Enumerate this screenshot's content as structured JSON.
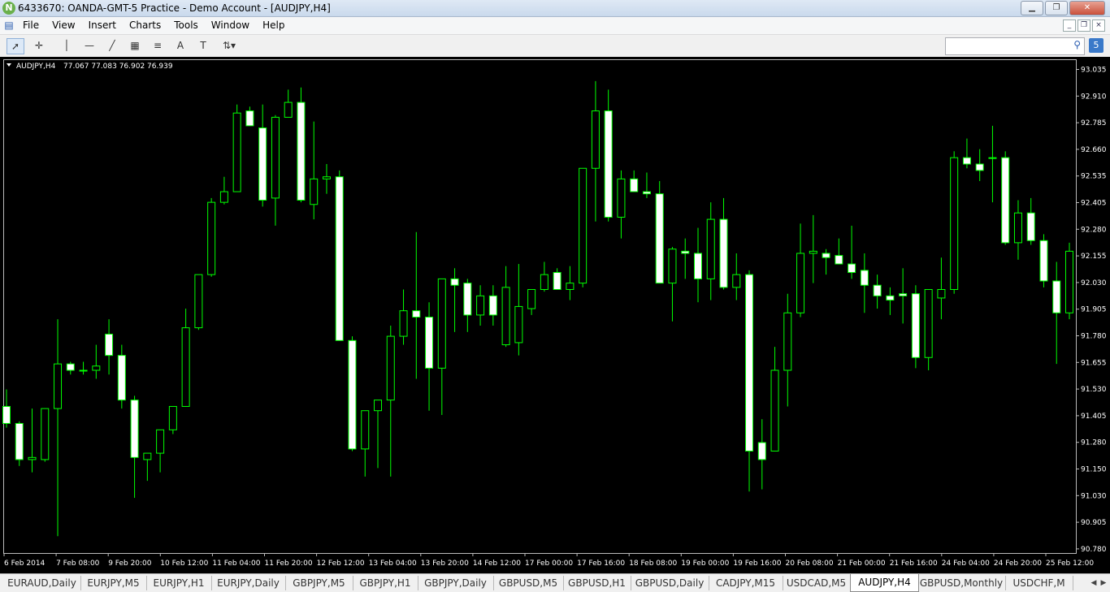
{
  "window": {
    "title": "6433670: OANDA-GMT-5 Practice - Demo Account - [AUDJPY,H4]",
    "app_icon": "N",
    "minimize": "▁",
    "maximize": "❐",
    "close": "✕"
  },
  "menu": {
    "items": [
      "File",
      "View",
      "Insert",
      "Charts",
      "Tools",
      "Window",
      "Help"
    ],
    "mdi": [
      "_",
      "❐",
      "×"
    ]
  },
  "toolbar": {
    "tools": [
      {
        "name": "cursor-icon",
        "glyph": "➚"
      },
      {
        "name": "crosshair-icon",
        "glyph": "✛"
      },
      {
        "name": "vertical-line-icon",
        "glyph": "│"
      },
      {
        "name": "horizontal-line-icon",
        "glyph": "—"
      },
      {
        "name": "trendline-icon",
        "glyph": "╱"
      },
      {
        "name": "equidistant-channel-icon",
        "glyph": "▦"
      },
      {
        "name": "fibonacci-icon",
        "glyph": "≡"
      },
      {
        "name": "text-icon",
        "glyph": "A"
      },
      {
        "name": "text-label-icon",
        "glyph": "T"
      },
      {
        "name": "arrows-icon",
        "glyph": "⇅▾"
      }
    ],
    "search_placeholder": "",
    "search_glyph": "⚲",
    "message_glyph": "5"
  },
  "colors": {
    "background": "#000000",
    "candle_line": "#00ff00",
    "bull_body": "#000000",
    "bear_body": "#ffffff",
    "text": "#ffffff"
  },
  "chart_data": {
    "type": "candlestick",
    "symbol_label": "AUDJPY,H4",
    "ohlc_label": "77.067 77.083 76.902 76.939",
    "y_ticks": [
      "93.035",
      "92.910",
      "92.785",
      "92.660",
      "92.535",
      "92.405",
      "92.280",
      "92.155",
      "92.030",
      "91.905",
      "91.780",
      "91.655",
      "91.530",
      "91.405",
      "91.280",
      "91.150",
      "91.030",
      "90.905",
      "90.780"
    ],
    "x_labels": [
      "6 Feb 2014",
      "7 Feb 08:00",
      "9 Feb 20:00",
      "10 Feb 12:00",
      "11 Feb 04:00",
      "11 Feb 20:00",
      "12 Feb 12:00",
      "13 Feb 04:00",
      "13 Feb 20:00",
      "14 Feb 12:00",
      "17 Feb 00:00",
      "17 Feb 16:00",
      "18 Feb 08:00",
      "19 Feb 00:00",
      "19 Feb 16:00",
      "20 Feb 08:00",
      "21 Feb 00:00",
      "21 Feb 16:00",
      "24 Feb 04:00",
      "24 Feb 20:00",
      "25 Feb 12:00"
    ],
    "ylim": [
      90.75,
      93.06
    ],
    "grid": false,
    "candles": [
      [
        91.45,
        91.53,
        91.35,
        91.37
      ],
      [
        91.37,
        91.38,
        91.17,
        91.2
      ],
      [
        91.2,
        91.44,
        91.14,
        91.21
      ],
      [
        91.2,
        91.44,
        91.19,
        91.44
      ],
      [
        91.44,
        91.86,
        90.84,
        91.65
      ],
      [
        91.65,
        91.66,
        91.6,
        91.62
      ],
      [
        91.62,
        91.66,
        91.6,
        91.62
      ],
      [
        91.62,
        91.74,
        91.58,
        91.64
      ],
      [
        91.79,
        91.86,
        91.6,
        91.69
      ],
      [
        91.69,
        91.74,
        91.44,
        91.48
      ],
      [
        91.48,
        91.5,
        91.02,
        91.21
      ],
      [
        91.2,
        91.23,
        91.1,
        91.23
      ],
      [
        91.23,
        91.33,
        91.14,
        91.34
      ],
      [
        91.34,
        91.45,
        91.32,
        91.45
      ],
      [
        91.45,
        91.91,
        91.45,
        91.82
      ],
      [
        91.82,
        92.07,
        91.81,
        92.07
      ],
      [
        92.07,
        92.43,
        92.06,
        92.41
      ],
      [
        92.41,
        92.53,
        92.4,
        92.46
      ],
      [
        92.46,
        92.87,
        92.46,
        92.83
      ],
      [
        92.84,
        92.86,
        92.79,
        92.77
      ],
      [
        92.76,
        92.87,
        92.39,
        92.42
      ],
      [
        92.43,
        92.82,
        92.3,
        92.81
      ],
      [
        92.81,
        92.94,
        92.81,
        92.88
      ],
      [
        92.88,
        92.95,
        92.41,
        92.42
      ],
      [
        92.4,
        92.79,
        92.33,
        92.52
      ],
      [
        92.52,
        92.59,
        92.45,
        92.53
      ],
      [
        92.53,
        92.56,
        91.76,
        91.76
      ],
      [
        91.76,
        91.78,
        91.24,
        91.25
      ],
      [
        91.25,
        91.43,
        91.12,
        91.43
      ],
      [
        91.43,
        91.48,
        91.16,
        91.48
      ],
      [
        91.48,
        91.83,
        91.12,
        91.78
      ],
      [
        91.78,
        92.0,
        91.74,
        91.9
      ],
      [
        91.9,
        92.27,
        91.58,
        91.87
      ],
      [
        91.87,
        91.94,
        91.43,
        91.63
      ],
      [
        91.63,
        92.05,
        91.41,
        92.05
      ],
      [
        92.05,
        92.1,
        91.8,
        92.02
      ],
      [
        92.03,
        92.05,
        91.8,
        91.88
      ],
      [
        91.88,
        92.02,
        91.83,
        91.97
      ],
      [
        91.97,
        92.02,
        91.83,
        91.88
      ],
      [
        91.74,
        92.11,
        91.73,
        92.01
      ],
      [
        91.75,
        92.12,
        91.69,
        91.92
      ],
      [
        91.91,
        92.0,
        91.88,
        92.0
      ],
      [
        92.0,
        92.13,
        91.99,
        92.07
      ],
      [
        92.08,
        92.1,
        92.04,
        92.0
      ],
      [
        92.0,
        92.11,
        91.95,
        92.03
      ],
      [
        92.03,
        92.57,
        92.01,
        92.57
      ],
      [
        92.57,
        92.98,
        92.32,
        92.84
      ],
      [
        92.84,
        92.94,
        92.32,
        92.34
      ],
      [
        92.34,
        92.56,
        92.24,
        92.52
      ],
      [
        92.52,
        92.56,
        92.46,
        92.46
      ],
      [
        92.46,
        92.55,
        92.43,
        92.45
      ],
      [
        92.45,
        92.51,
        92.06,
        92.03
      ],
      [
        92.03,
        92.2,
        91.85,
        92.19
      ],
      [
        92.18,
        92.24,
        92.05,
        92.17
      ],
      [
        92.17,
        92.29,
        91.94,
        92.05
      ],
      [
        92.05,
        92.41,
        91.95,
        92.33
      ],
      [
        92.33,
        92.43,
        92.0,
        92.01
      ],
      [
        92.01,
        92.17,
        91.95,
        92.07
      ],
      [
        92.07,
        92.09,
        91.05,
        91.24
      ],
      [
        91.28,
        91.39,
        91.06,
        91.2
      ],
      [
        91.24,
        91.73,
        91.24,
        91.62
      ],
      [
        91.62,
        91.98,
        91.45,
        91.89
      ],
      [
        91.89,
        92.31,
        91.87,
        92.17
      ],
      [
        92.17,
        92.35,
        92.03,
        92.18
      ],
      [
        92.17,
        92.19,
        92.07,
        92.15
      ],
      [
        92.16,
        92.24,
        92.12,
        92.12
      ],
      [
        92.12,
        92.3,
        92.05,
        92.08
      ],
      [
        92.09,
        92.17,
        91.89,
        92.02
      ],
      [
        92.02,
        92.07,
        91.91,
        91.97
      ],
      [
        91.97,
        92.01,
        91.88,
        91.95
      ],
      [
        91.98,
        92.1,
        91.84,
        91.97
      ],
      [
        91.98,
        92.02,
        91.63,
        91.68
      ],
      [
        91.68,
        91.98,
        91.62,
        92.0
      ],
      [
        91.96,
        92.15,
        91.86,
        92.0
      ],
      [
        92.0,
        92.65,
        91.98,
        92.62
      ],
      [
        92.62,
        92.71,
        92.57,
        92.59
      ],
      [
        92.59,
        92.66,
        92.51,
        92.56
      ],
      [
        92.62,
        92.77,
        92.41,
        92.62
      ],
      [
        92.62,
        92.65,
        92.21,
        92.22
      ],
      [
        92.22,
        92.42,
        92.14,
        92.36
      ],
      [
        92.36,
        92.43,
        92.21,
        92.23
      ],
      [
        92.23,
        92.26,
        92.01,
        92.04
      ],
      [
        92.04,
        92.13,
        91.65,
        91.89
      ],
      [
        91.89,
        92.22,
        91.86,
        92.18
      ]
    ]
  },
  "tabs": [
    "EURAUD,Daily",
    "EURJPY,M5",
    "EURJPY,H1",
    "EURJPY,Daily",
    "GBPJPY,M5",
    "GBPJPY,H1",
    "GBPJPY,Daily",
    "GBPUSD,M5",
    "GBPUSD,H1",
    "GBPUSD,Daily",
    "CADJPY,M15",
    "USDCAD,M5",
    "AUDJPY,H4",
    "GBPUSD,Monthly",
    "USDCHF,M"
  ],
  "active_tab": "AUDJPY,H4",
  "tab_scroll": {
    "left": "◀",
    "right": "▶"
  }
}
